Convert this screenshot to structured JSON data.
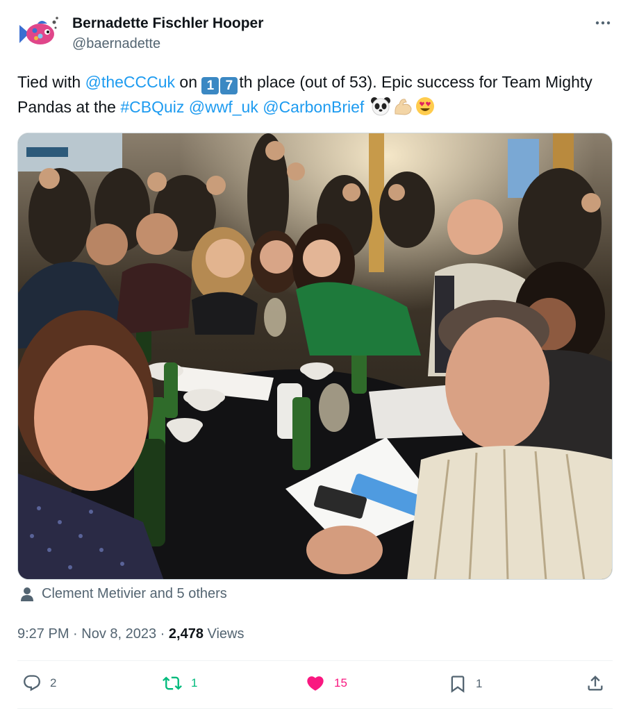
{
  "post": {
    "author": {
      "display_name": "Bernadette Fischler Hooper",
      "handle": "@baernadette",
      "avatar_icon": "fish-avatar-icon"
    },
    "text": {
      "part1": "Tied with ",
      "mention1": "@theCCCuk",
      "part2": " on ",
      "keycap1": "1",
      "keycap2": "7",
      "part3": "th place (out of 53). Epic success for Team Mighty Pandas at the ",
      "hashtag": "#CBQuiz",
      "space1": " ",
      "mention2": "@wwf_uk",
      "space2": " ",
      "mention3": "@CarbonBrief",
      "emojis": [
        "panda-face",
        "flexed-biceps",
        "smiling-face-with-heart-eyes"
      ]
    },
    "tagged_people": "Clement Metivier and 5 others",
    "timestamp": "9:27 PM · Nov 8, 2023 · ",
    "views_count": "2,478",
    "views_label": " Views",
    "actions": {
      "replies": "2",
      "reposts": "1",
      "likes": "15",
      "bookmarks": "1"
    },
    "colors": {
      "link": "#1d9bf0",
      "secondary": "#536471",
      "repost": "#00ba7c",
      "like": "#f91880"
    }
  }
}
